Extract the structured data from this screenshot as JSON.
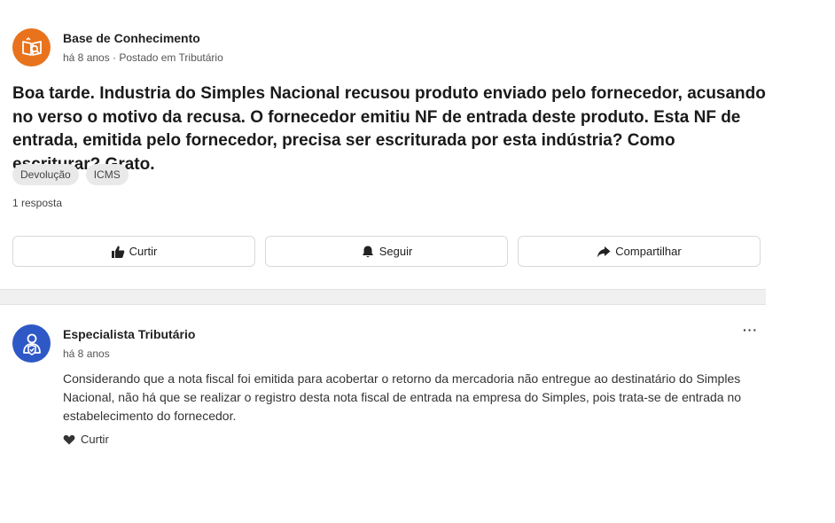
{
  "post": {
    "author_name": "Base de Conhecimento",
    "meta": "há 8 anos · Postado em Tributário",
    "question": "Boa tarde. Industria do Simples Nacional recusou produto enviado pelo fornecedor, acusando no verso o motivo da recusa. O fornecedor emitiu NF de entrada deste produto. Esta NF de entrada, emitida pelo fornecedor, precisa ser escriturada por esta indústria? Como escriturar? Grato.",
    "tags": [
      "Devolução",
      "ICMS"
    ],
    "answers_count": "1 resposta",
    "actions": {
      "like": "Curtir",
      "follow": "Seguir",
      "share": "Compartilhar"
    },
    "avatar_icon": "book-search-icon"
  },
  "answer": {
    "author_name": "Especialista Tributário",
    "meta": "há 8 anos",
    "more_label": "···",
    "text": "Considerando que a nota fiscal foi emitida para acobertar o retorno da mercadoria não entregue ao destinatário do Simples Nacional, não há que se realizar o registro desta nota fiscal de entrada na empresa do Simples, pois trata-se de entrada no estabelecimento do fornecedor.",
    "like_label": "Curtir",
    "avatar_icon": "expert-shield-icon"
  },
  "colors": {
    "accent_orange": "#e8731c",
    "accent_blue": "#2f58c7"
  }
}
